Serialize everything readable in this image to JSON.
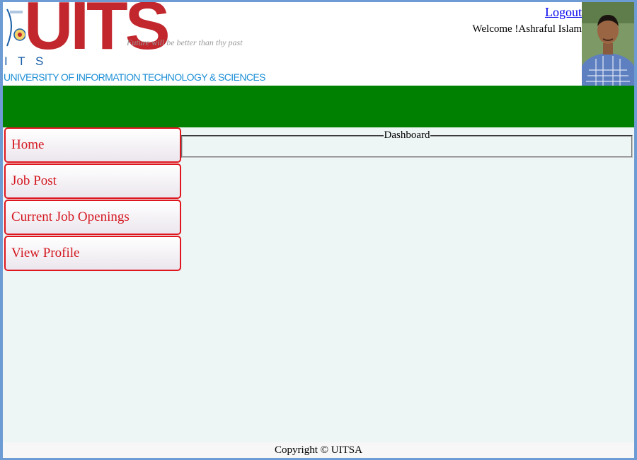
{
  "header": {
    "logo": {
      "letters": "UITS",
      "short": "I T S",
      "seal_text": "UNIVERSITY",
      "tagline": "Future will be better than thy past",
      "full_name": "UNIVERSITY OF INFORMATION TECHNOLOGY & SCIENCES"
    },
    "logout_label": "Logout",
    "welcome_text": "Welcome !Ashraful Islam"
  },
  "sidebar": {
    "items": [
      {
        "label": "Home"
      },
      {
        "label": "Job Post"
      },
      {
        "label": "Current Job Openings"
      },
      {
        "label": "View Profile"
      }
    ]
  },
  "main": {
    "panel_title": "Dashboard"
  },
  "footer": {
    "copyright": "Copyright © UITSA"
  },
  "colors": {
    "header_bar": "#008000",
    "nav_border": "#e0161e",
    "nav_text": "#d4171f",
    "logo_red": "#c1272d",
    "logo_blue": "#1d8fd6",
    "content_bg": "#eef6f5",
    "frame": "#6d9bd3"
  }
}
